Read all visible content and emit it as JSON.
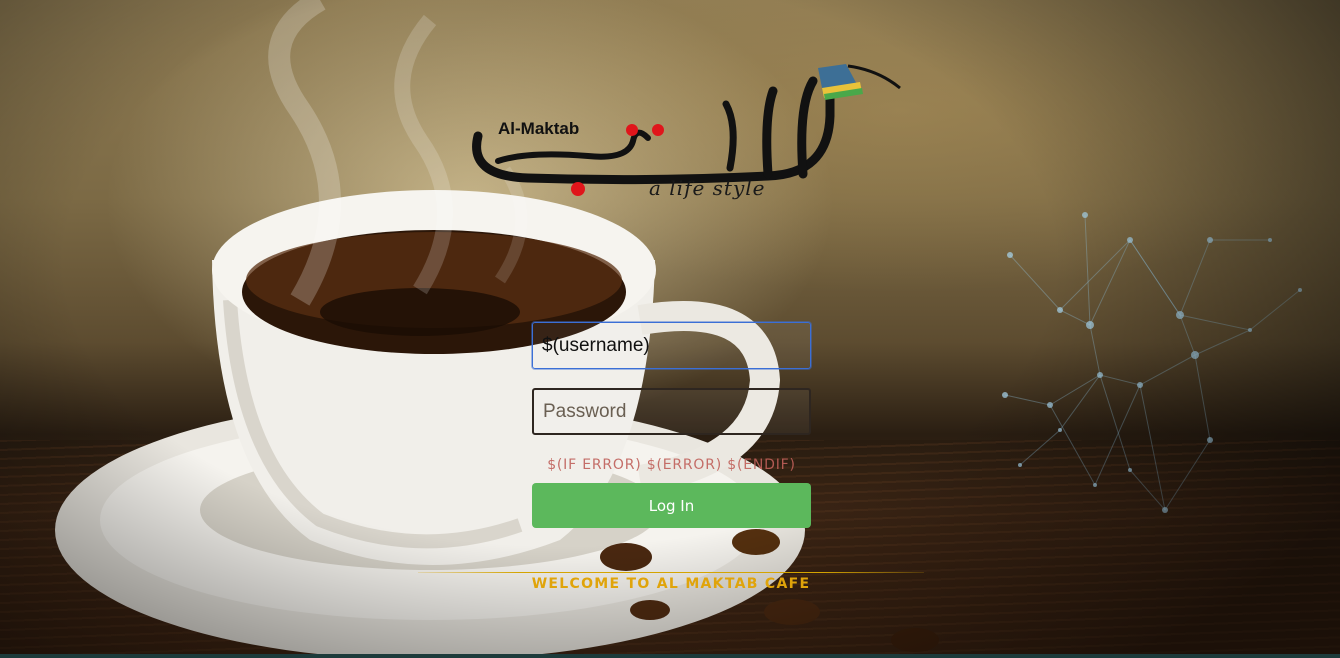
{
  "logo": {
    "latin_name": "Al-Maktab",
    "tagline": "a life style"
  },
  "login": {
    "username_value": "$(username)",
    "password_placeholder": "Password",
    "error_text": "$(IF ERROR) $(ERROR) $(ENDIF)",
    "submit_label": "Log In"
  },
  "footer": {
    "welcome_text": "WELCOME TO AL MAKTAB CAFE"
  },
  "colors": {
    "button": "#5cb85c",
    "welcome": "#e0a40a",
    "error": "#c0605a",
    "focus_border": "#3b6fd6"
  }
}
